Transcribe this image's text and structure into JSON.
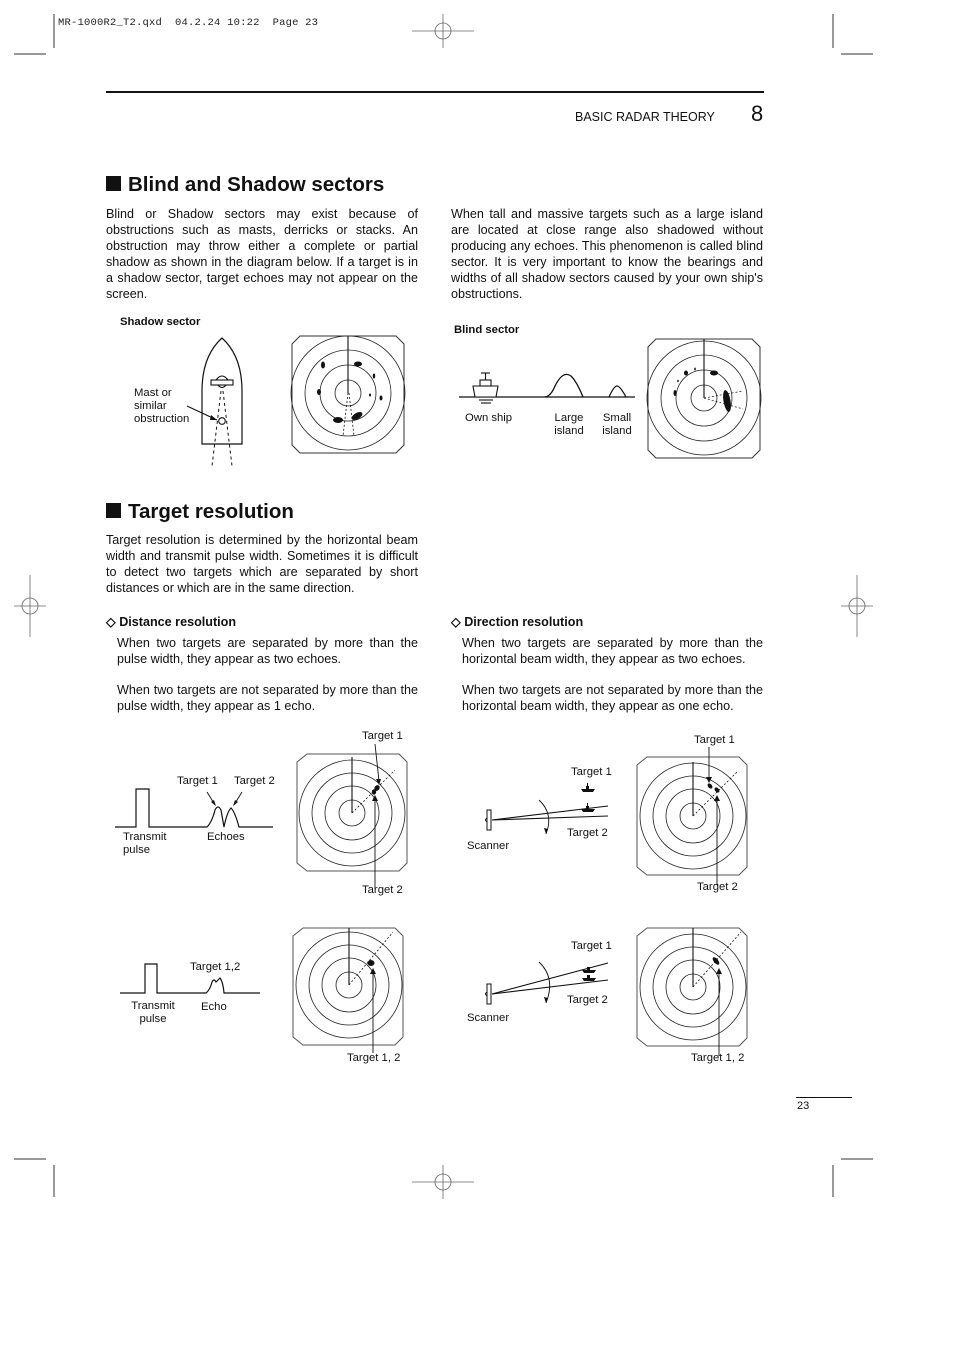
{
  "slug": {
    "file": "MR-1000R2_T2.qxd",
    "date": "04.2.24",
    "time": "10:22",
    "page_label": "Page 23"
  },
  "header": {
    "section_title": "BASIC RADAR THEORY",
    "section_number": "8"
  },
  "blind_shadow": {
    "heading": "Blind and Shadow sectors",
    "para_left": "Blind or Shadow sectors may exist because of obstructions such as masts, derricks or stacks. An obstruction may throw either a complete or partial shadow as shown in the diagram below. If a target is in a shadow sector, target echoes may not appear on the screen.",
    "para_right": "When tall and massive targets such as a large island are located at close range also shadowed without producing any echoes. This phenomenon is called blind sector. It is very important to know the bearings and widths of all shadow sectors caused by your own ship's obstructions.",
    "shadow_diagram": {
      "title": "Shadow sector",
      "mast_label_1": "Mast or",
      "mast_label_2": "similar",
      "mast_label_3": "obstruction"
    },
    "blind_diagram": {
      "title": "Blind sector",
      "own_ship": "Own ship",
      "large_island_1": "Large",
      "large_island_2": "island",
      "small_island_1": "Small",
      "small_island_2": "island"
    }
  },
  "target_resolution": {
    "heading": "Target resolution",
    "intro": "Target resolution is determined by the horizontal beam width and transmit pulse width. Sometimes it is difficult to detect two targets which are separated by short distances or which are in the same direction.",
    "distance": {
      "title": "Distance resolution",
      "para1": "When two targets are separated by more than the pulse width, they appear as two echoes.",
      "para2": "When two targets are not separated by more than the pulse width, they appear as 1 echo.",
      "diagram1": {
        "target1": "Target 1",
        "target2": "Target 2",
        "transmit_1": "Transmit",
        "transmit_2": "pulse",
        "echoes": "Echoes",
        "radar_target1": "Target 1",
        "radar_target2": "Target 2"
      },
      "diagram2": {
        "target12": "Target 1,2",
        "transmit_1": "Transmit",
        "transmit_2": "pulse",
        "echo": "Echo",
        "radar_target12": "Target 1, 2"
      }
    },
    "direction": {
      "title": "Direction resolution",
      "para1": "When two targets are separated by more than the horizontal beam width, they appear as two echoes.",
      "para2": "When two targets are not separated by more than the horizontal beam width, they appear as one echo.",
      "diagram1": {
        "target1": "Target 1",
        "target2": "Target 2",
        "scanner": "Scanner",
        "radar_target1": "Target 1",
        "radar_target2": "Target 2"
      },
      "diagram2": {
        "target1": "Target 1",
        "target2": "Target 2",
        "scanner": "Scanner",
        "radar_target12": "Target 1, 2"
      }
    }
  },
  "footer": {
    "page_number": "23"
  }
}
